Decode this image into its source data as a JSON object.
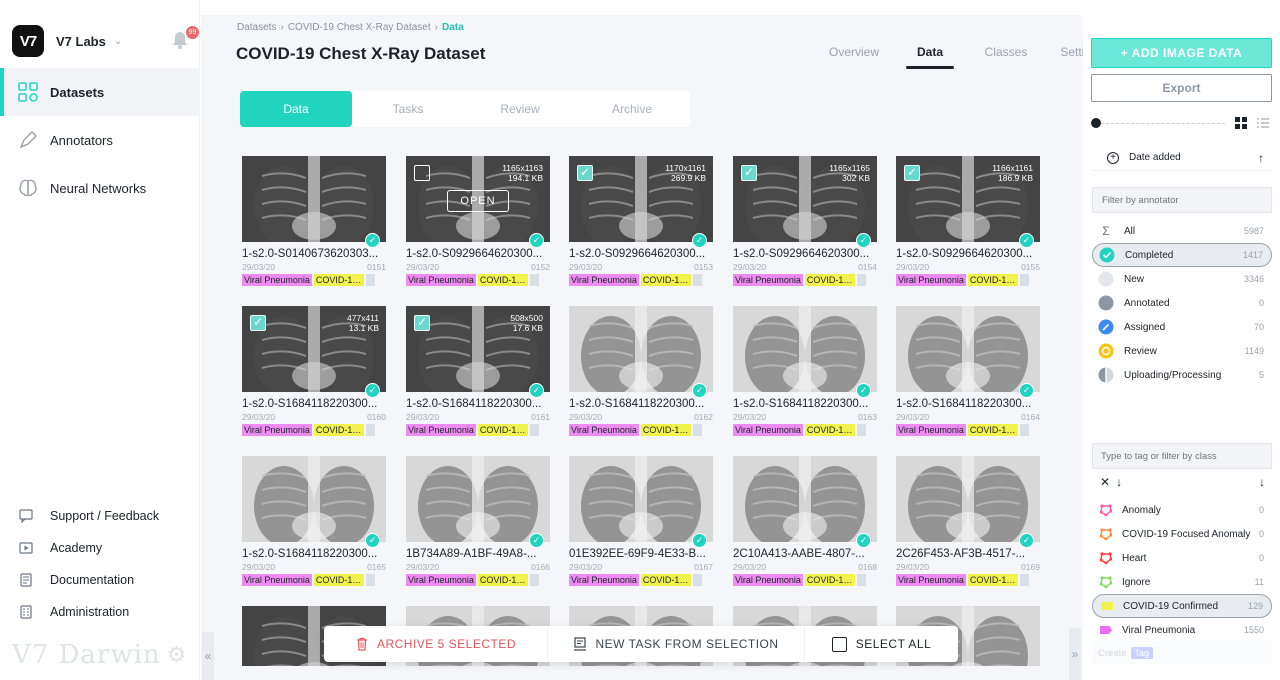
{
  "org": {
    "logo": "V7",
    "name": "V7 Labs",
    "notifications": "99"
  },
  "nav": [
    {
      "label": "Datasets",
      "icon": "datasets-icon",
      "active": true
    },
    {
      "label": "Annotators",
      "icon": "annotators-icon",
      "active": false
    },
    {
      "label": "Neural Networks",
      "icon": "brain-icon",
      "active": false
    }
  ],
  "bottom_nav": [
    {
      "label": "Support / Feedback",
      "icon": "chat-icon"
    },
    {
      "label": "Academy",
      "icon": "play-icon"
    },
    {
      "label": "Documentation",
      "icon": "document-icon"
    },
    {
      "label": "Administration",
      "icon": "admin-icon"
    }
  ],
  "brand": {
    "text": "V7 Darwin"
  },
  "breadcrumb": [
    "Datasets",
    "COVID-19 Chest X-Ray Dataset",
    "Data"
  ],
  "page_title": "COVID-19 Chest X-Ray Dataset",
  "top_tabs": [
    {
      "label": "Overview",
      "active": false
    },
    {
      "label": "Data",
      "active": true
    },
    {
      "label": "Classes",
      "active": false
    },
    {
      "label": "Settings",
      "active": false
    }
  ],
  "sub_tabs": [
    {
      "label": "Data",
      "active": true
    },
    {
      "label": "Tasks",
      "active": false
    },
    {
      "label": "Review",
      "active": false
    },
    {
      "label": "Archive",
      "active": false
    }
  ],
  "tags_default": {
    "a": "Viral Pneumonia",
    "b": "COVID-19 Confirmed"
  },
  "items": [
    {
      "name": "1-s2.0-S0140673620303...",
      "date": "29/03/20",
      "num": "0151",
      "checkbox": "none",
      "dims": "",
      "size": "",
      "open": false,
      "done": true
    },
    {
      "name": "1-s2.0-S0929664620300...",
      "date": "29/03/20",
      "num": "0152",
      "checkbox": "off",
      "dims": "1165x1163",
      "size": "194.1 KB",
      "open": true,
      "done": true
    },
    {
      "name": "1-s2.0-S0929664620300...",
      "date": "29/03/20",
      "num": "0153",
      "checkbox": "on",
      "dims": "1170x1161",
      "size": "269.9 KB",
      "open": false,
      "done": true
    },
    {
      "name": "1-s2.0-S0929664620300...",
      "date": "29/03/20",
      "num": "0154",
      "checkbox": "on",
      "dims": "1165x1165",
      "size": "302 KB",
      "open": false,
      "done": true
    },
    {
      "name": "1-s2.0-S0929664620300...",
      "date": "29/03/20",
      "num": "0155",
      "checkbox": "on",
      "dims": "1166x1161",
      "size": "186.9 KB",
      "open": false,
      "done": true
    },
    {
      "name": "1-s2.0-S1684118220300...",
      "date": "29/03/20",
      "num": "0160",
      "checkbox": "on",
      "dims": "477x411",
      "size": "13.1 KB",
      "open": false,
      "done": true
    },
    {
      "name": "1-s2.0-S1684118220300...",
      "date": "29/03/20",
      "num": "0161",
      "checkbox": "on",
      "dims": "508x500",
      "size": "17.6 KB",
      "open": false,
      "done": true
    },
    {
      "name": "1-s2.0-S1684118220300...",
      "date": "29/03/20",
      "num": "0162",
      "checkbox": "none",
      "dims": "",
      "size": "",
      "open": false,
      "done": true
    },
    {
      "name": "1-s2.0-S1684118220300...",
      "date": "29/03/20",
      "num": "0163",
      "checkbox": "none",
      "dims": "",
      "size": "",
      "open": false,
      "done": true
    },
    {
      "name": "1-s2.0-S1684118220300...",
      "date": "29/03/20",
      "num": "0164",
      "checkbox": "none",
      "dims": "",
      "size": "",
      "open": false,
      "done": true
    },
    {
      "name": "1-s2.0-S1684118220300...",
      "date": "29/03/20",
      "num": "0165",
      "checkbox": "none",
      "dims": "",
      "size": "",
      "open": false,
      "done": true
    },
    {
      "name": "1B734A89-A1BF-49A8-...",
      "date": "29/03/20",
      "num": "0166",
      "checkbox": "none",
      "dims": "",
      "size": "",
      "open": false,
      "done": true
    },
    {
      "name": "01E392EE-69F9-4E33-B...",
      "date": "29/03/20",
      "num": "0167",
      "checkbox": "none",
      "dims": "",
      "size": "",
      "open": false,
      "done": true
    },
    {
      "name": "2C10A413-AABE-4807-...",
      "date": "29/03/20",
      "num": "0168",
      "checkbox": "none",
      "dims": "",
      "size": "",
      "open": false,
      "done": true
    },
    {
      "name": "2C26F453-AF3B-4517-...",
      "date": "29/03/20",
      "num": "0169",
      "checkbox": "none",
      "dims": "",
      "size": "",
      "open": false,
      "done": true
    }
  ],
  "action_bar": {
    "archive": "ARCHIVE 5 SELECTED",
    "new_task": "NEW TASK FROM SELECTION",
    "select_all": "SELECT ALL"
  },
  "right_panel": {
    "add_button": "+ ADD IMAGE DATA",
    "export_button": "Export",
    "sort_label": "Date added",
    "filter_placeholder": "Filter by annotator",
    "statuses": [
      {
        "label": "All",
        "count": "5987",
        "icon": "sigma",
        "color": "#1c2229",
        "active": false
      },
      {
        "label": "Completed",
        "count": "1417",
        "icon": "check",
        "color": "#21d4c0",
        "active": true
      },
      {
        "label": "New",
        "count": "3346",
        "icon": "circle",
        "color": "#e3e7ec",
        "active": false
      },
      {
        "label": "Annotated",
        "count": "0",
        "icon": "circle",
        "color": "#8c97a3",
        "active": false
      },
      {
        "label": "Assigned",
        "count": "70",
        "icon": "pen",
        "color": "#3c8cf0",
        "active": false
      },
      {
        "label": "Review",
        "count": "1149",
        "icon": "ring",
        "color": "#f5c518",
        "active": false
      },
      {
        "label": "Uploading/Processing",
        "count": "5",
        "icon": "half",
        "color": "#8c97a3",
        "active": false
      }
    ],
    "tag_placeholder": "Type to tag or filter by class",
    "classes": [
      {
        "label": "Anomaly",
        "count": "0",
        "color": "#ff5aa8",
        "active": false
      },
      {
        "label": "COVID-19 Focused Anomaly",
        "count": "0",
        "color": "#ff8a3c",
        "active": false
      },
      {
        "label": "Heart",
        "count": "0",
        "color": "#ff3c3c",
        "active": false
      },
      {
        "label": "Ignore",
        "count": "11",
        "color": "#7ee05a",
        "active": false
      },
      {
        "label": "COVID-19 Confirmed",
        "count": "129",
        "color": "#f2f24d",
        "active": true
      },
      {
        "label": "Viral Pneumonia",
        "count": "1550",
        "color": "#ec6cf0",
        "active": false
      }
    ],
    "create_label": "Create",
    "create_tag": "Tag"
  }
}
